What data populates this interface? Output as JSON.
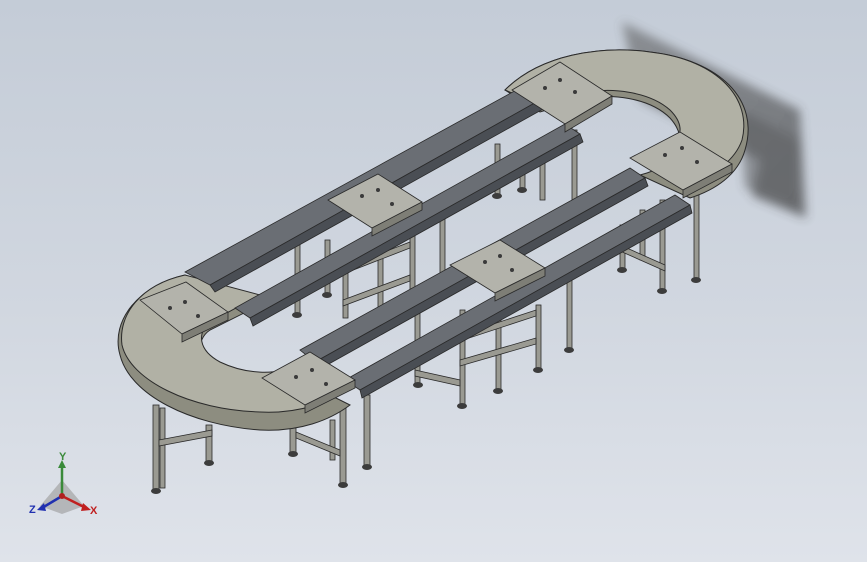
{
  "viewport": {
    "background_top": "#c4ccd7",
    "background_bottom": "#dfe3ea"
  },
  "model": {
    "surface_color": "#8d8d80",
    "surface_top_color": "#b1b1a5",
    "edge_color": "#2a2a2a",
    "rail_color": "#5a5e64",
    "leg_color": "#9a9a92",
    "plate_color": "#b3b3ab"
  },
  "triad": {
    "y_label": "Y",
    "x_label": "X",
    "z_label": "Z",
    "y_color": "#3a8a3a",
    "x_color": "#c02020",
    "z_color": "#2030b0"
  }
}
